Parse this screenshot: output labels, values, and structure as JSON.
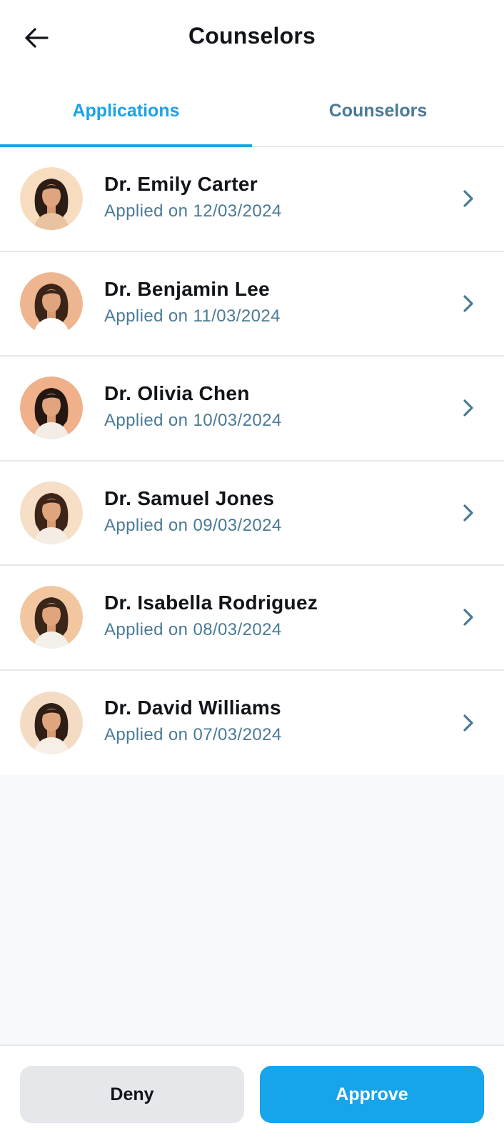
{
  "header": {
    "title": "Counselors",
    "back_icon": "arrow-left-icon"
  },
  "tabs": [
    {
      "label": "Applications",
      "active": true
    },
    {
      "label": "Counselors",
      "active": false
    }
  ],
  "colors": {
    "accent": "#1aa3e8",
    "secondary_text": "#4a7a95",
    "primary_text": "#111418",
    "deny_bg": "#e5e7eb",
    "approve_bg": "#16a4ea"
  },
  "applications": [
    {
      "name": "Dr. Emily Carter",
      "applied": "Applied on 12/03/2024",
      "avatar_bg": "#f7dcc0"
    },
    {
      "name": "Dr. Benjamin Lee",
      "applied": "Applied on 11/03/2024",
      "avatar_bg": "#eeb690"
    },
    {
      "name": "Dr. Olivia Chen",
      "applied": "Applied on 10/03/2024",
      "avatar_bg": "#efb08a"
    },
    {
      "name": "Dr. Samuel Jones",
      "applied": "Applied on 09/03/2024",
      "avatar_bg": "#f7dec6"
    },
    {
      "name": "Dr. Isabella Rodriguez",
      "applied": "Applied on 08/03/2024",
      "avatar_bg": "#f2c7a0"
    },
    {
      "name": "Dr. David Williams",
      "applied": "Applied on 07/03/2024",
      "avatar_bg": "#f4dcc4"
    }
  ],
  "footer": {
    "deny_label": "Deny",
    "approve_label": "Approve"
  }
}
